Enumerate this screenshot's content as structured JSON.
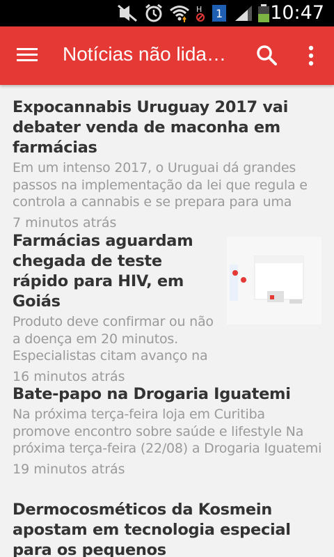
{
  "statusbar": {
    "time": "10:47",
    "icons": [
      "mute-icon",
      "alarm-icon",
      "wifi-icon",
      "no-data-icon",
      "notification-1-icon",
      "signal-icon",
      "battery-icon"
    ]
  },
  "appbar": {
    "title": "Notícias não lida…",
    "color": "#e53935"
  },
  "articles": [
    {
      "headline": "Expocannabis Uruguay 2017 vai debater venda de maconha em farmácias",
      "summary": "Em um intenso 2017, o Uruguai dá grandes passos na implementação da lei que regula e controla a cannabis e se prepara para uma",
      "time": "7 minutos atrás"
    },
    {
      "headline": "Farmácias aguardam chegada de teste rápido para HIV, em Goiás",
      "summary": "Produto deve confirmar ou não a doença em 20 minutos. Especialistas citam avanço na",
      "time": "16 minutos atrás",
      "thumbnail": "hiv-test-kit-image"
    },
    {
      "headline": "Bate-papo na Drogaria Iguatemi",
      "summary": "Na próxima terça-feira loja em Curitiba promove encontro sobre saúde e lifestyle Na próxima terça-feira (22/08) a Drogaria Iguatemi",
      "time": "19 minutos atrás"
    },
    {
      "headline": "Dermocosméticos da Kosmein apostam em tecnologia especial para os pequenos",
      "summary": "",
      "time": ""
    }
  ]
}
